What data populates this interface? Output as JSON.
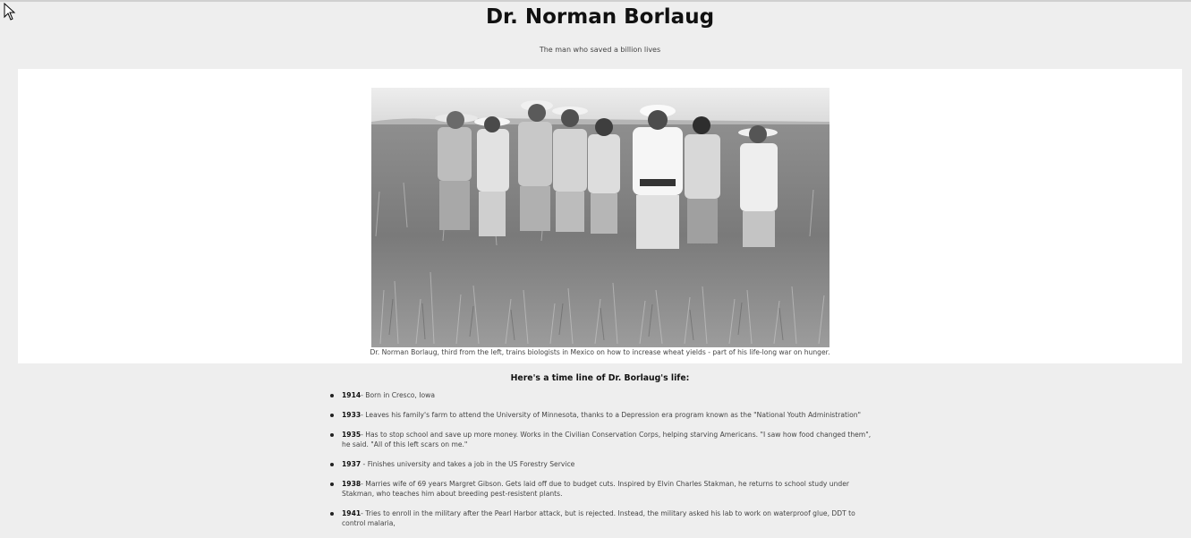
{
  "page": {
    "title": "Dr. Norman Borlaug",
    "subtitle": "The man who saved a billion lives"
  },
  "figure": {
    "caption": "Dr. Norman Borlaug, third from the left, trains biologists in Mexico on how to increase wheat yields - part of his life-long war on hunger."
  },
  "timeline": {
    "heading": "Here's a time line of Dr. Borlaug's life:",
    "items": [
      {
        "year": "1914",
        "text": "- Born in Cresco, Iowa"
      },
      {
        "year": "1933",
        "text": "- Leaves his family's farm to attend the University of Minnesota, thanks to a Depression era program known as the \"National Youth Administration\""
      },
      {
        "year": "1935",
        "text": "- Has to stop school and save up more money. Works in the Civilian Conservation Corps, helping starving Americans. \"I saw how food changed them\", he said. \"All of this left scars on me.\""
      },
      {
        "year": "1937",
        "text": " - Finishes university and takes a job in the US Forestry Service"
      },
      {
        "year": "1938",
        "text": "- Marries wife of 69 years Margret Gibson. Gets laid off due to budget cuts. Inspired by Elvin Charles Stakman, he returns to school study under Stakman, who teaches him about breeding pest-resistent plants."
      },
      {
        "year": "1941",
        "text": "- Tries to enroll in the military after the Pearl Harbor attack, but is rejected. Instead, the military asked his lab to work on waterproof glue, DDT to control malaria,"
      }
    ]
  }
}
